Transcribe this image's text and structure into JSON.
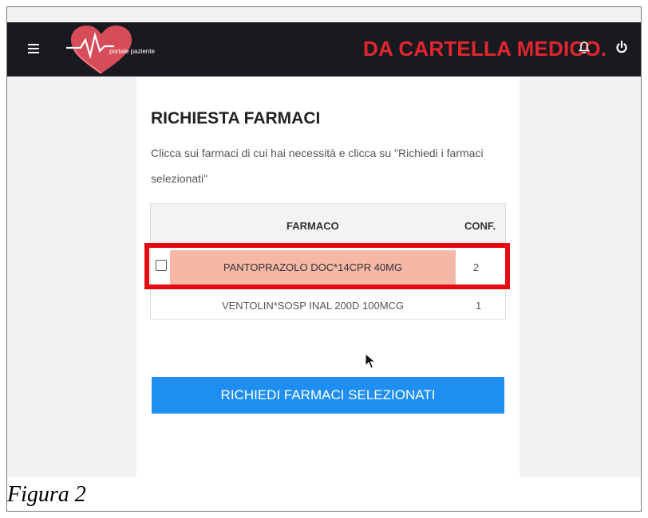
{
  "header": {
    "logo_text": "portale paziente",
    "title": "DA CARTELLA MEDICO.",
    "menu_icon": "hamburger-icon",
    "bell_icon": "bell-icon",
    "power_icon": "power-icon"
  },
  "main": {
    "title": "RICHIESTA FARMACI",
    "description": "Clicca sui farmaci di cui hai necessità e clicca su \"Richiedi i farmaci selezionati\"",
    "table": {
      "columns": [
        "FARMACO",
        "CONF."
      ],
      "rows": [
        {
          "name": "PANTOPRAZOLO DOC*14CPR 40MG",
          "conf": "2"
        },
        {
          "name": "VENTOLIN*SOSP INAL 200D 100MCG",
          "conf": "1"
        }
      ]
    },
    "submit_button": "RICHIEDI FARMACI SELEZIONATI"
  },
  "caption": "Figura 2",
  "colors": {
    "topbar": "#181a20",
    "brand_red": "#e3262d",
    "highlight_row": "#f5b8a6",
    "annotation_red": "#e40b12",
    "button_blue": "#1f8ef1"
  }
}
